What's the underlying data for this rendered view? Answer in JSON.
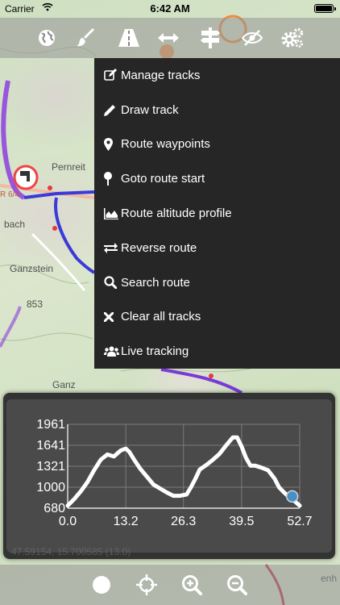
{
  "status_bar": {
    "carrier": "Carrier",
    "time": "6:42 AM"
  },
  "map": {
    "place_labels": [
      "Pernreit",
      "bach",
      "Ganzstein",
      "853",
      "Ganz",
      "enh"
    ],
    "road_label": "R 6/4",
    "coordinates": "47.59154, 15.700585 (13.0)"
  },
  "toolbar": {
    "icons": [
      "globe-icon",
      "brush-icon",
      "road-icon",
      "arrows-horizontal-icon",
      "signpost-icon",
      "eye-slash-icon",
      "gears-icon"
    ]
  },
  "menu": {
    "items": [
      {
        "label": "Manage tracks",
        "icon": "edit-icon"
      },
      {
        "label": "Draw track",
        "icon": "pencil-icon"
      },
      {
        "label": "Route waypoints",
        "icon": "map-marker-icon"
      },
      {
        "label": "Goto route start",
        "icon": "pushpin-icon"
      },
      {
        "label": "Route altitude profile",
        "icon": "area-chart-icon"
      },
      {
        "label": "Reverse route",
        "icon": "exchange-icon"
      },
      {
        "label": "Search route",
        "icon": "search-icon"
      },
      {
        "label": "Clear all tracks",
        "icon": "times-icon"
      },
      {
        "label": "Live tracking",
        "icon": "users-icon"
      }
    ]
  },
  "altitude_chart": {
    "y_ticks": [
      "1961",
      "1641",
      "1321",
      "1000",
      "680"
    ],
    "x_ticks": [
      "0.0",
      "13.2",
      "26.3",
      "39.5",
      "52.7"
    ]
  },
  "chart_data": {
    "type": "line",
    "title": "",
    "xlabel": "",
    "ylabel": "",
    "xlim": [
      0.0,
      52.7
    ],
    "ylim": [
      680,
      1961
    ],
    "grid": true,
    "series": [
      {
        "x": [
          0.0,
          1.5,
          3.0,
          4.5,
          6.0,
          7.5,
          9.0,
          10.5,
          12.0,
          13.2,
          14.0,
          15.0,
          16.5,
          18.0,
          19.5,
          21.0,
          22.5,
          24.0,
          25.5,
          27.0,
          28.0,
          29.0,
          30.0,
          31.5,
          33.0,
          34.5,
          36.0,
          37.5,
          38.5,
          39.5,
          40.5,
          41.5,
          42.5,
          44.0,
          45.5,
          47.0,
          48.0,
          49.0,
          50.0,
          51.0,
          52.0,
          52.7
        ],
        "values": [
          720,
          820,
          940,
          1080,
          1260,
          1420,
          1500,
          1470,
          1560,
          1590,
          1540,
          1430,
          1280,
          1160,
          1040,
          980,
          920,
          870,
          870,
          890,
          1000,
          1130,
          1270,
          1340,
          1420,
          1510,
          1640,
          1760,
          1760,
          1620,
          1450,
          1330,
          1330,
          1300,
          1260,
          1130,
          1000,
          930,
          870,
          820,
          760,
          720
        ]
      }
    ],
    "current_position": {
      "x": 51.0,
      "y": 860
    },
    "colors": {
      "line": "#ffffff",
      "marker": "#4a8fc4",
      "grid": "#7a7a7a"
    }
  },
  "bottom_bar": {
    "icons": [
      "circle-icon",
      "crosshairs-icon",
      "zoom-in-icon",
      "zoom-out-icon"
    ]
  }
}
